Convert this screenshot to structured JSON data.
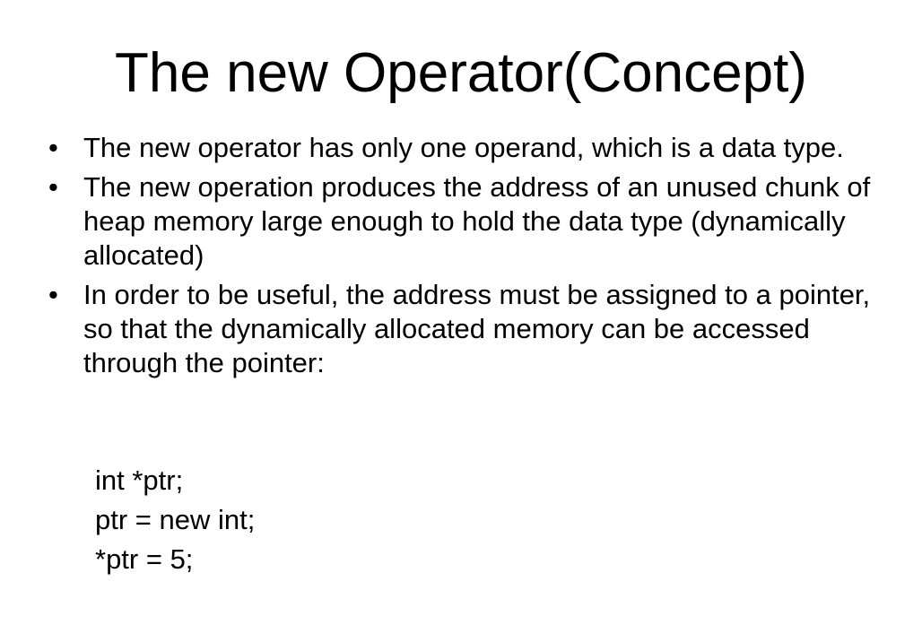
{
  "slide": {
    "title": "The new Operator(Concept)",
    "bullets": [
      "The new operator has only one operand, which is a data type.",
      "The new operation produces the address of an unused chunk of heap memory large enough to hold the data type (dynamically allocated)",
      "In order to be useful, the address must be assigned to a pointer, so that the dynamically allocated memory can be accessed through the pointer:"
    ],
    "bullet_marker": "•",
    "code_lines": [
      "int *ptr;",
      "ptr = new int;",
      "*ptr = 5;"
    ]
  }
}
